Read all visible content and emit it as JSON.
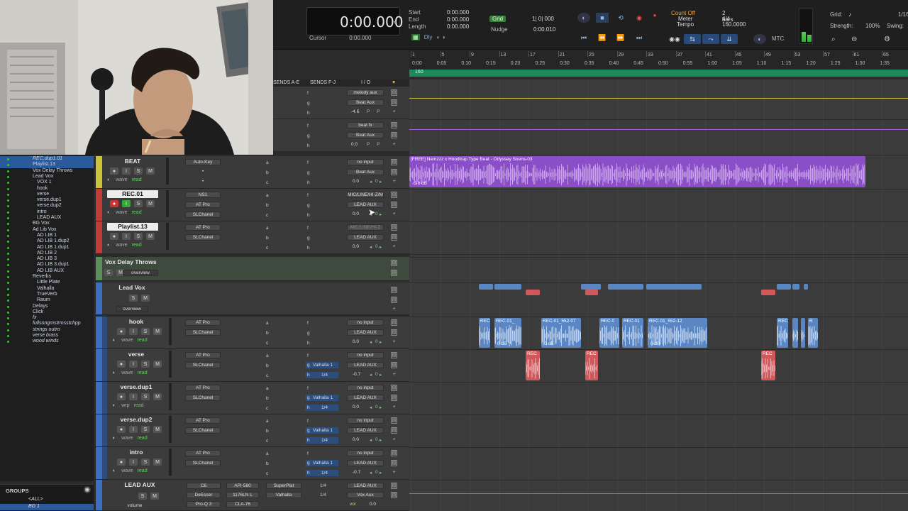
{
  "transport": {
    "main_counter": "0:00.000",
    "cursor_label": "Cursor",
    "cursor_value": "0:00.000",
    "selection": {
      "start_label": "Start",
      "start_value": "0:00.000",
      "end_label": "End",
      "end_value": "0:00.000",
      "length_label": "Length",
      "length_value": "0:00.000"
    },
    "dly_label": "Dly",
    "grid_tag": "Grid",
    "grid_value": "1| 0| 000",
    "nudge_label": "Nudge",
    "nudge_value": "0:00.010",
    "count_off": "Count Off",
    "count_off_value": "2 bars",
    "meter_label": "Meter",
    "meter_value": "4/4",
    "tempo_label": "Tempo",
    "tempo_value": "160.0000",
    "mtc_label": "MTC",
    "grid_right_label": "Grid:",
    "grid_right_value": "1/16",
    "strength_label": "Strength:",
    "strength_value": "100%",
    "swing_label": "Swing:"
  },
  "ruler": {
    "bars": [
      "1",
      "5",
      "9",
      "13",
      "17",
      "21",
      "25",
      "29",
      "33",
      "37",
      "41",
      "45",
      "49",
      "53",
      "57",
      "61",
      "65"
    ],
    "times": [
      "0:00",
      "0:05",
      "0:10",
      "0:15",
      "0:20",
      "0:25",
      "0:30",
      "0:35",
      "0:40",
      "0:45",
      "0:50",
      "0:55",
      "1:00",
      "1:05",
      "1:10",
      "1:15",
      "1:20",
      "1:25",
      "1:30",
      "1:35"
    ],
    "tempo_marker": "160"
  },
  "column_heads": {
    "sends_ae": "SENDS A-E",
    "sends_fj": "SENDS F-J",
    "io": "I / O"
  },
  "tracklist": [
    {
      "label": "REC.dup1.01",
      "indent": 46,
      "italic": true,
      "hl": true
    },
    {
      "label": "Playlist.13",
      "indent": 46,
      "italic": false,
      "hl": true
    },
    {
      "label": "Vox Delay Throws",
      "indent": 46,
      "italic": false,
      "hl": false
    },
    {
      "label": "Lead Vox",
      "indent": 46,
      "italic": false,
      "hl": false
    },
    {
      "label": "VOX 1",
      "indent": 52,
      "italic": false,
      "hl": false
    },
    {
      "label": "hook",
      "indent": 52,
      "italic": false,
      "hl": false
    },
    {
      "label": "verse",
      "indent": 52,
      "italic": false,
      "hl": false
    },
    {
      "label": "verse.dup1",
      "indent": 52,
      "italic": false,
      "hl": false
    },
    {
      "label": "verse.dup2",
      "indent": 52,
      "italic": false,
      "hl": false
    },
    {
      "label": "intro",
      "indent": 52,
      "italic": false,
      "hl": false
    },
    {
      "label": "LEAD AUX",
      "indent": 52,
      "italic": false,
      "hl": false
    },
    {
      "label": "BG Vox",
      "indent": 46,
      "italic": false,
      "hl": false
    },
    {
      "label": "Ad Lib Vox",
      "indent": 46,
      "italic": false,
      "hl": false
    },
    {
      "label": "AD LIB 1",
      "indent": 52,
      "italic": false,
      "hl": false
    },
    {
      "label": "AD LIB 1.dup2",
      "indent": 52,
      "italic": false,
      "hl": false
    },
    {
      "label": "AD LIB 1.dup1",
      "indent": 52,
      "italic": false,
      "hl": false
    },
    {
      "label": "AD LIB 2",
      "indent": 52,
      "italic": false,
      "hl": false
    },
    {
      "label": "AD LIB 3",
      "indent": 52,
      "italic": false,
      "hl": false
    },
    {
      "label": "AD LIB 3.dup1",
      "indent": 52,
      "italic": false,
      "hl": false
    },
    {
      "label": "AD LIB AUX",
      "indent": 52,
      "italic": false,
      "hl": false
    },
    {
      "label": "Reverbs",
      "indent": 46,
      "italic": false,
      "hl": false
    },
    {
      "label": "Little Plate",
      "indent": 52,
      "italic": false,
      "hl": false
    },
    {
      "label": "Valhalla",
      "indent": 52,
      "italic": false,
      "hl": false
    },
    {
      "label": "TrueVerb",
      "indent": 52,
      "italic": false,
      "hl": false
    },
    {
      "label": "Raum",
      "indent": 52,
      "italic": false,
      "hl": false
    },
    {
      "label": "Delays",
      "indent": 46,
      "italic": false,
      "hl": false
    },
    {
      "label": "Click",
      "indent": 46,
      "italic": false,
      "hl": false
    },
    {
      "label": "fx",
      "indent": 46,
      "italic": true,
      "hl": false
    },
    {
      "label": "fullsongmstrmsstchpp",
      "indent": 46,
      "italic": true,
      "hl": false
    },
    {
      "label": "strings outro",
      "indent": 46,
      "italic": true,
      "hl": false
    },
    {
      "label": "verse brass",
      "indent": 46,
      "italic": true,
      "hl": false
    },
    {
      "label": "wood winds",
      "indent": 46,
      "italic": true,
      "hl": false
    }
  ],
  "groups": {
    "title": "GROUPS",
    "rows": [
      "<ALL>",
      "BG 1"
    ]
  },
  "top_rows": [
    {
      "send_f": "f",
      "send_g": "g",
      "send_h": "h",
      "io_in": "melody aux",
      "io_out": "Beat Aux",
      "vol": "-4.6"
    },
    {
      "send_f": "f",
      "send_g": "g",
      "send_h": "h",
      "io_in": "beat fx",
      "io_out": "Beat Aux",
      "vol": "0.0"
    }
  ],
  "tracks": [
    {
      "key": "beat",
      "name": "BEAT",
      "boxed": false,
      "color": "#c9c23a",
      "view": "wave",
      "mode": "read",
      "ins1": "Auto-Key",
      "ins2": "",
      "io_in": "no input",
      "io_out": "Beat Aux",
      "vol": "0.0",
      "rec": false
    },
    {
      "key": "rec01",
      "name": "REC.01",
      "boxed": true,
      "color": "#c23a3a",
      "view": "wave",
      "mode": "read",
      "ins1": "NS1",
      "ins1b": "AT Pro",
      "ins1c": "SLChanel",
      "io_in": "MIC/LINE/HI-Z/M",
      "io_out": "LEAD AUX",
      "vol": "0.0",
      "rec": true
    },
    {
      "key": "playlist13",
      "name": "Playlist.13",
      "boxed": true,
      "color": "#c23a3a",
      "view": "wave",
      "mode": "read",
      "ins1": "AT Pro",
      "ins1b": "SLChanel",
      "io_in": "MIC/LINE/HI-Z",
      "io_out": "LEAD AUX",
      "vol": "0.0",
      "rec": false
    }
  ],
  "folders": {
    "vox_delay": {
      "name": "Vox Delay Throws",
      "view": "overview"
    },
    "lead_vox": {
      "name": "Lead Vox",
      "view": "overview"
    }
  },
  "vox_tracks": [
    {
      "name": "hook",
      "ins1": "AT Pro",
      "ins1b": "SLChanel",
      "send": "",
      "send2": "",
      "io_in": "no input",
      "io_out": "LEAD AUX",
      "vol": "0.0",
      "view": "wave",
      "mode": "read"
    },
    {
      "name": "verse",
      "ins1": "AT Pro",
      "ins1b": "SLChanel",
      "send": "Valhalla 1",
      "send2": "1/4",
      "io_in": "no input",
      "io_out": "LEAD AUX",
      "vol": "-0.7",
      "view": "wave",
      "mode": "read"
    },
    {
      "name": "verse.dup1",
      "ins1": "AT Pro",
      "ins1b": "SLChanel",
      "send": "Valhalla 1",
      "send2": "1/4",
      "io_in": "no input",
      "io_out": "LEAD AUX",
      "vol": "0.0",
      "view": "wrp",
      "mode": "read"
    },
    {
      "name": "verse.dup2",
      "ins1": "AT Pro",
      "ins1b": "SLChanel",
      "send": "Valhalla 1",
      "send2": "1/4",
      "io_in": "no input",
      "io_out": "LEAD AUX",
      "vol": "0.0",
      "view": "wave",
      "mode": "read"
    },
    {
      "name": "intro",
      "ins1": "AT Pro",
      "ins1b": "SLChanel",
      "send": "Valhalla 1",
      "send2": "1/4",
      "io_in": "no input",
      "io_out": "LEAD AUX",
      "vol": "-0.7",
      "view": "wave",
      "mode": "read"
    }
  ],
  "lead_aux": {
    "name": "LEAD AUX",
    "view": "volume",
    "ins": [
      "C6",
      "DeEsser",
      "Pro-Q 3"
    ],
    "ins2": [
      "API-560",
      "1176LN L",
      "CLA-76"
    ],
    "ins3": [
      "SuperPlat",
      "Valhalla",
      ""
    ],
    "send_a": "1/4",
    "send_b": "1/4",
    "io_in": "LEAD AUX",
    "io_out": "Vox Aux",
    "vol_label": "vol",
    "vol": "0.0"
  },
  "clips": {
    "beat": {
      "name": "[FREE] Nemzzz x Hoodtrap Type Beat - Odyssey Sirens-03",
      "db": "-5.6 dB"
    },
    "hook": [
      {
        "name": "REC"
      },
      {
        "name": "REC.01_",
        "db": "0 dB"
      },
      {
        "name": "REC.01_552-07",
        "db": "0 dB"
      },
      {
        "name": "REC.0"
      },
      {
        "name": "REC.01"
      },
      {
        "name": "REC.01_552-12",
        "db": "0 dB"
      },
      {
        "name": "REC"
      },
      {
        "name": "R"
      }
    ],
    "verse_labels": [
      "REC",
      "REC",
      "REC"
    ]
  },
  "colors": {
    "beat": "#c9c23a",
    "rec": "#c23a3a",
    "vox": "#3a6fc2",
    "folder": "#5a8f5a",
    "purple_clip": "#8a4ec6",
    "blue_clip": "#5a86c4",
    "red_clip": "#d0575a"
  }
}
